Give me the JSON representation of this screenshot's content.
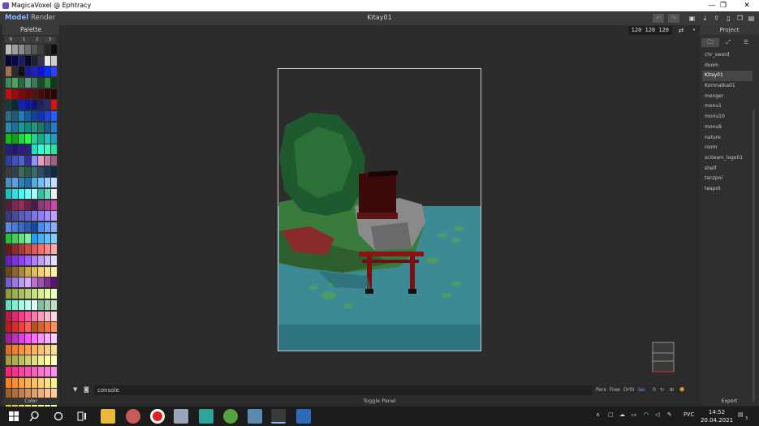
{
  "window": {
    "title": "MagicaVoxel @ Ephtracy",
    "minimize": "—",
    "maximize": "❐",
    "close": "✕"
  },
  "menu": {
    "model_label": "Model",
    "render_label": "Render",
    "document_title": "Kitay01"
  },
  "palette": {
    "header": "Palette",
    "tabs": [
      "0",
      "1",
      "2",
      "3"
    ],
    "footer": "Color",
    "selected_index": 276,
    "colors": [
      "#bdbdbd",
      "#9e9e9e",
      "#8a8a8a",
      "#6e6e6e",
      "#545454",
      "#3d3d3d",
      "#262626",
      "#0e0e0e",
      "#04043a",
      "#050550",
      "#1a1a70",
      "#0a0a2a",
      "#1f1f2f",
      "#333355",
      "#e8e8e8",
      "#d0d0d0",
      "#a07050",
      "#2a2a2a",
      "#101010",
      "#1a1aa0",
      "#2020c0",
      "#1010e0",
      "#0030ff",
      "#3040ff",
      "#3a8a5a",
      "#52a060",
      "#2a6a3a",
      "#5a9a7a",
      "#3a7a5a",
      "#1a4a2a",
      "#2a8a3a",
      "#0c3a1a",
      "#c01010",
      "#a00808",
      "#800606",
      "#6a0808",
      "#551010",
      "#4a0a0a",
      "#3a0505",
      "#2a0303",
      "#1a3a3a",
      "#0a2a30",
      "#1020c0",
      "#0818a0",
      "#101080",
      "#202060",
      "#2a2a70",
      "#e01010",
      "#2a6a8a",
      "#1a5a7a",
      "#1a80c0",
      "#1060a0",
      "#1040a0",
      "#1030c0",
      "#2040e0",
      "#2060ff",
      "#2a8aa8",
      "#1a70a0",
      "#1a9a9a",
      "#108a8a",
      "#209a7a",
      "#1a7a6a",
      "#1a5a8a",
      "#2080d0",
      "#10c010",
      "#10a010",
      "#10e040",
      "#20ff40",
      "#20d0a0",
      "#10b080",
      "#20c0c0",
      "#20a0c0",
      "#202080",
      "#201870",
      "#301890",
      "#2a2080",
      "#20e0c0",
      "#30ffe0",
      "#40ffc0",
      "#30e0a0",
      "#3040a0",
      "#4050c0",
      "#5060d0",
      "#3030a0",
      "#9090ff",
      "#e0a0c0",
      "#c080a0",
      "#a06080",
      "#3a3a3a",
      "#304050",
      "#406a5a",
      "#2a5a4a",
      "#3a6a6a",
      "#2a4a6a",
      "#1a3a5a",
      "#0a2a4a",
      "#4a90c0",
      "#60a0e0",
      "#3080c0",
      "#2070b0",
      "#50b0e0",
      "#70c0ff",
      "#9ad0ff",
      "#c0e0ff",
      "#1ac0c0",
      "#30e0e0",
      "#40ffff",
      "#70ffff",
      "#a0ffff",
      "#30c0a0",
      "#60e0c0",
      "#f0f0f0",
      "#5a1a3a",
      "#7a2a5a",
      "#9a2a5a",
      "#6a2050",
      "#4a1a4a",
      "#8a3a7a",
      "#aa3a8a",
      "#cc4aaa",
      "#3a3a7a",
      "#4a4a9a",
      "#5a5abf",
      "#6060d0",
      "#7a7ae0",
      "#8a80ff",
      "#a090ff",
      "#c0a0ff",
      "#5a8ae0",
      "#4a7ad0",
      "#3a6ac0",
      "#2a5ab0",
      "#1a4aa0",
      "#4a8aff",
      "#6aa0ff",
      "#8ab0ff",
      "#20c040",
      "#40d060",
      "#60e080",
      "#80f0a0",
      "#20a0ff",
      "#40b0ff",
      "#60c0ff",
      "#80d0ff",
      "#6a1a1a",
      "#8a2a2a",
      "#aa3a3a",
      "#cc4a4a",
      "#e05a5a",
      "#ff6a6a",
      "#ff8a8a",
      "#ffaaaa",
      "#6a20c0",
      "#8030e0",
      "#9040ff",
      "#a060ff",
      "#b080ff",
      "#c0a0ff",
      "#d0c0ff",
      "#e0e0ff",
      "#6a4a1a",
      "#8a6a2a",
      "#aa8a3a",
      "#ccaa4a",
      "#e0c05a",
      "#ffd06a",
      "#ffe08a",
      "#fff0aa",
      "#7a5ad0",
      "#9a7ae0",
      "#ba9af0",
      "#daaaff",
      "#c070d0",
      "#a050b0",
      "#803090",
      "#601070",
      "#8aa040",
      "#9ab050",
      "#aac060",
      "#bad070",
      "#cae080",
      "#daf090",
      "#eaffa0",
      "#f0ffc0",
      "#60e0c0",
      "#80f0d0",
      "#a0ffe0",
      "#c0fff0",
      "#e0ffff",
      "#80c0a0",
      "#a0d0b0",
      "#c0e0c0",
      "#c01a4a",
      "#e02a6a",
      "#ff3a8a",
      "#ff5aa0",
      "#ff7ab0",
      "#ff9ac0",
      "#ffbad0",
      "#ffdae0",
      "#c01a1a",
      "#e02a2a",
      "#ff3a3a",
      "#ff5a5a",
      "#c0501a",
      "#e0602a",
      "#ff703a",
      "#ff905a",
      "#a020a0",
      "#c030c0",
      "#e040e0",
      "#ff50ff",
      "#ff70ff",
      "#ff90ff",
      "#ffb0ff",
      "#ffd0ff",
      "#e07020",
      "#f08030",
      "#ff9040",
      "#ffa050",
      "#ffb060",
      "#ffc070",
      "#ffd080",
      "#ffe090",
      "#a0a040",
      "#b0b050",
      "#c0c060",
      "#d0d070",
      "#e0e080",
      "#f0f090",
      "#ffffa0",
      "#ffffc0",
      "#ff2080",
      "#ff3090",
      "#ff40a0",
      "#ff50b0",
      "#ff60c0",
      "#ff70d0",
      "#ff80e0",
      "#ff90f0",
      "#ff8020",
      "#ff9030",
      "#ffa040",
      "#ffb050",
      "#ffc060",
      "#ffd070",
      "#ffe080",
      "#fff090",
      "#a0602a",
      "#b0703a",
      "#c0804a",
      "#d0905a",
      "#e0a06a",
      "#f0b07a",
      "#ffc08a",
      "#ffd09a",
      "#ffc020",
      "#ffd030",
      "#ffe040",
      "#fff050",
      "#ffff60",
      "#ffff80",
      "#ffffa0",
      "#ffffc0",
      "#e04040",
      "#f05050",
      "#ff6060",
      "#ff7070",
      "#ff8080",
      "#ff9090",
      "#ffa0a0",
      "#ffb0b0",
      "#ffffff",
      "#f0e0e0",
      "#a03030",
      "#802020",
      "#602020",
      "#401010",
      "#201010",
      "#100808"
    ]
  },
  "viewport": {
    "dims": "120 120 120",
    "swap_icon": "⇄",
    "console_placeholder": "console",
    "view_modes": [
      "Pers",
      "Free",
      "Orth",
      "Iso"
    ],
    "active_view_mode": "Iso",
    "zoom_value": "0",
    "toggle_panel": "Toggle Panel"
  },
  "project": {
    "header": "Project",
    "tabs": [
      "🗀",
      "⤢",
      "☰"
    ],
    "items": [
      "chr_sword",
      "doom",
      "Kitay01",
      "Komnatka01",
      "menger",
      "monu1",
      "monu10",
      "monu9",
      "nature",
      "room",
      "sciteam_logo01",
      "shelf",
      "tanzpol",
      "teapot"
    ],
    "selected": "Kitay01",
    "footer": "Export"
  },
  "taskbar": {
    "lang": "РУС",
    "time": "14:52",
    "date": "20.04.2021",
    "notification_count": "3"
  },
  "colors": {
    "water": "#3b8a94",
    "tree": "#1f5a2e",
    "torii": "#7a1010",
    "accent": "#6ea6ff"
  }
}
